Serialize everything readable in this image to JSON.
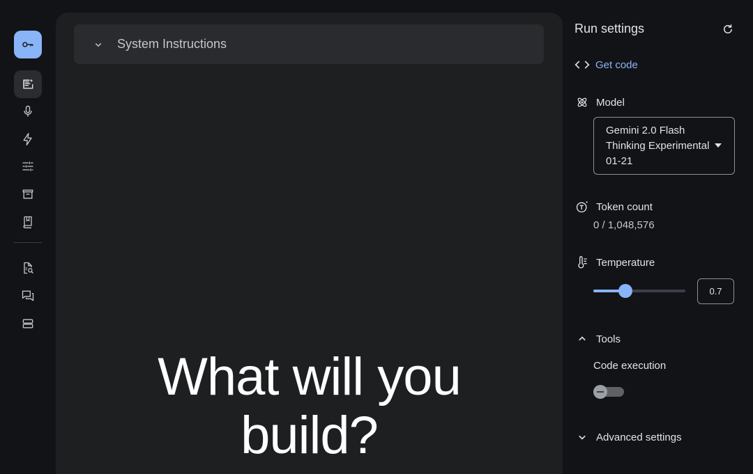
{
  "nav": {
    "items": [
      {
        "icon": "key-icon"
      },
      {
        "icon": "chat-prompt-icon",
        "active": true
      },
      {
        "icon": "microphone-icon"
      },
      {
        "icon": "bolt-icon"
      },
      {
        "icon": "tune-icon"
      },
      {
        "icon": "archive-icon"
      },
      {
        "icon": "book-icon"
      },
      {
        "icon": "doc-search-icon"
      },
      {
        "icon": "forum-icon"
      },
      {
        "icon": "storage-icon"
      }
    ]
  },
  "main": {
    "system_instructions_label": "System Instructions",
    "hero_line1": "What will you",
    "hero_line2": "build?"
  },
  "settings": {
    "title": "Run settings",
    "get_code_label": "Get code",
    "model_label": "Model",
    "model_value_line1": "Gemini 2.0 Flash",
    "model_value_line2": "Thinking Experimental",
    "model_value_line3": "01-21",
    "token_count_label": "Token count",
    "token_count_value": "0 / 1,048,576",
    "temperature_label": "Temperature",
    "temperature_value": "0.7",
    "temperature_fraction": 0.35,
    "tools_label": "Tools",
    "code_execution_label": "Code execution",
    "code_execution_enabled": false,
    "advanced_settings_label": "Advanced settings"
  },
  "colors": {
    "accent": "#8ab4f8",
    "panel": "#1e1f20",
    "background": "#121316"
  }
}
